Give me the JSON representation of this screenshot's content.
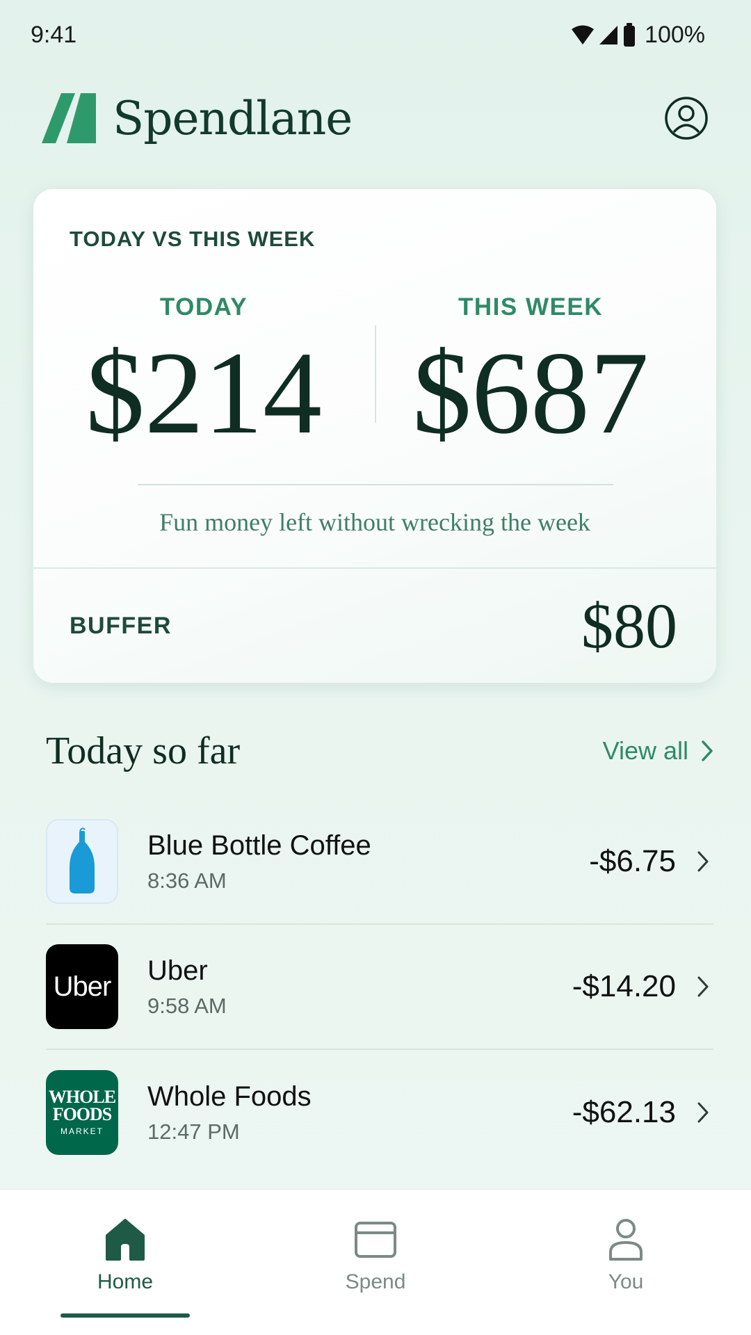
{
  "status_bar": {
    "time": "9:41",
    "battery": "100%"
  },
  "header": {
    "app_name": "Spendlane",
    "brand_color": "#2e9a6c",
    "profile_icon": "account-circle-icon"
  },
  "summary": {
    "heading": "TODAY VS THIS WEEK",
    "today_label": "TODAY",
    "today_value": "$214",
    "week_label": "THIS WEEK",
    "week_value": "$687",
    "tagline": "Fun money left without wrecking the week",
    "buffer_label": "BUFFER",
    "buffer_value": "$80"
  },
  "today_section": {
    "title": "Today so far",
    "view_all": "View all",
    "transactions": [
      {
        "merchant": "Blue Bottle Coffee",
        "time": "8:36 AM",
        "amount": "-$6.75",
        "logo": "blue-bottle-logo"
      },
      {
        "merchant": "Uber",
        "time": "9:58 AM",
        "amount": "-$14.20",
        "logo": "uber-logo",
        "logo_text": "Uber"
      },
      {
        "merchant": "Whole Foods",
        "time": "12:47 PM",
        "amount": "-$62.13",
        "logo": "whole-foods-logo",
        "logo_lines": [
          "WHOLE",
          "FOODS",
          "MARKET"
        ]
      }
    ]
  },
  "bottom_nav": {
    "items": [
      {
        "label": "Home",
        "icon": "home-icon",
        "active": true
      },
      {
        "label": "Spend",
        "icon": "card-icon",
        "active": false
      },
      {
        "label": "You",
        "icon": "person-icon",
        "active": false
      }
    ]
  },
  "colors": {
    "accent": "#2e8a66",
    "dark": "#0f2d22",
    "active_nav": "#1e5a45"
  }
}
